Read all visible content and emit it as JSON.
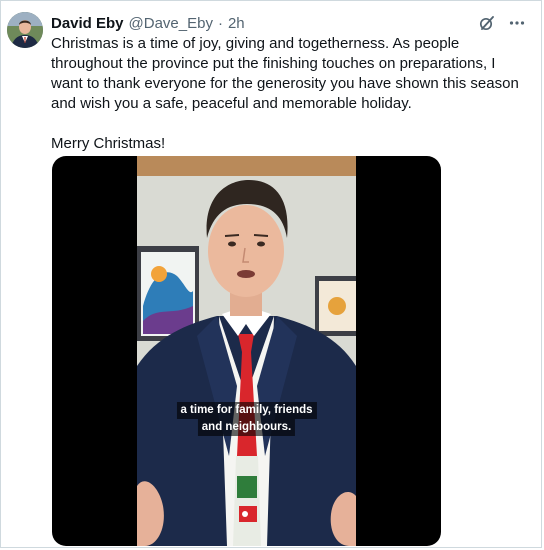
{
  "tweet": {
    "author_name": "David Eby",
    "handle": "@Dave_Eby",
    "separator": "·",
    "time": "2h",
    "text_paragraph_1": "Christmas is a time of joy, giving and togetherness. As people throughout the province put the finishing touches on preparations, I want to thank everyone for the generosity you have shown this season and wish you a safe, peaceful and memorable holiday.",
    "text_paragraph_2": "Merry Christmas!",
    "video_caption_line_1": "a time for family, friends",
    "video_caption_line_2": "and neighbours."
  },
  "icons": {
    "grok": "grok-icon",
    "more": "more-icon"
  },
  "colors": {
    "text": "#0f1419",
    "secondary": "#536471",
    "border": "#cfd9de"
  }
}
